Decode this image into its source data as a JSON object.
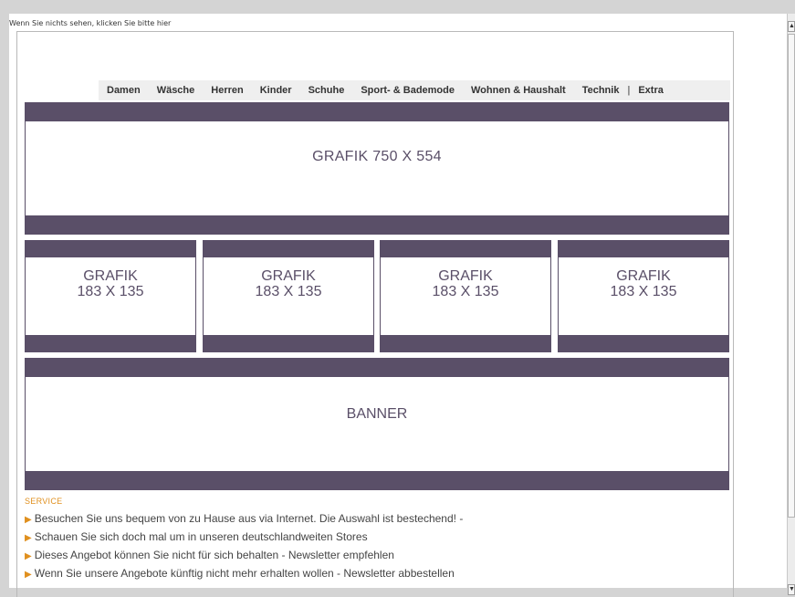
{
  "top_note": "Wenn Sie nichts sehen, klicken Sie bitte hier",
  "nav": {
    "items": [
      "Damen",
      "Wäsche",
      "Herren",
      "Kinder",
      "Schuhe",
      "Sport- & Bademode",
      "Wohnen & Haushalt",
      "Technik"
    ],
    "separator": "|",
    "extra": "Extra"
  },
  "hero": {
    "label": "GRAFIK 750 X 554"
  },
  "tiles": [
    {
      "line1": "GRAFIK",
      "line2": "183 X 135"
    },
    {
      "line1": "GRAFIK",
      "line2": "183 X 135"
    },
    {
      "line1": "GRAFIK",
      "line2": "183 X 135"
    },
    {
      "line1": "GRAFIK",
      "line2": "183 X 135"
    }
  ],
  "banner": {
    "label": "BANNER"
  },
  "service": {
    "title": "SERVICE",
    "items": [
      "Besuchen Sie uns bequem von zu Hause aus via Internet. Die Auswahl ist bestechend! -",
      "Schauen Sie sich doch mal um in unseren deutschlandweiten Stores",
      "Dieses Angebot können Sie nicht für sich behalten - Newsletter empfehlen",
      "Wenn Sie unsere Angebote künftig nicht mehr erhalten wollen - Newsletter abbestellen"
    ]
  },
  "colors": {
    "accent": "#5a4f68",
    "service_orange": "#e0901f"
  }
}
